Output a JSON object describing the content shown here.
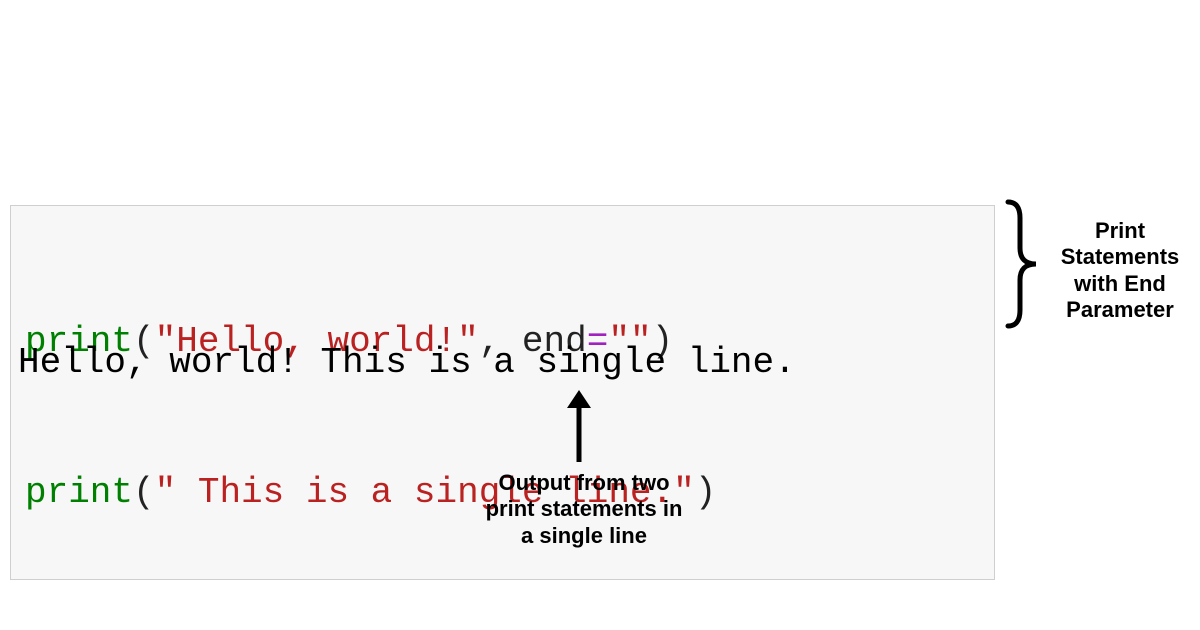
{
  "code": {
    "line1": {
      "func": "print",
      "open_paren": "(",
      "string": "\"Hello, world!\"",
      "comma": ",",
      "space": " ",
      "param": "end",
      "equals": "=",
      "value": "\"\"",
      "close_paren": ")"
    },
    "line2": {
      "func": "print",
      "open_paren": "(",
      "string": "\" This is a single line.\"",
      "close_paren": ")"
    }
  },
  "output": "Hello, world! This is a single line.",
  "annotations": {
    "right": "Print Statements with End Parameter",
    "bottom": "Output from two print statements in a single line"
  }
}
